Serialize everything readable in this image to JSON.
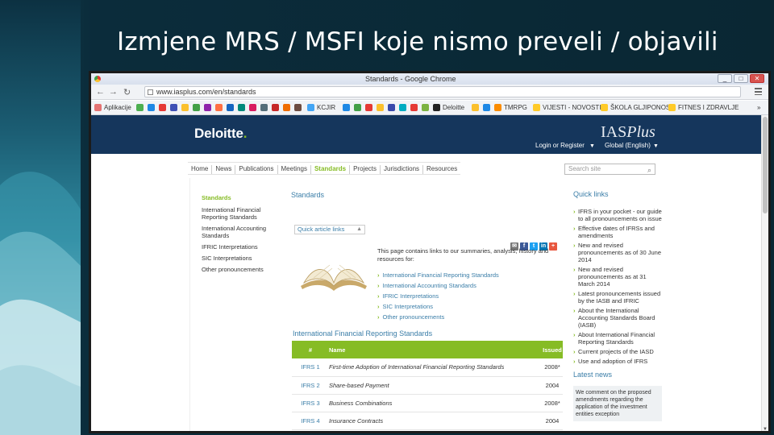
{
  "slide": {
    "title": "Izmjene MRS / MSFI koje nismo preveli / objavili"
  },
  "browser": {
    "window_title": "Standards - Google Chrome",
    "url": "www.iasplus.com/en/standards",
    "buttons": {
      "minimize": "_",
      "maximize": "□",
      "close": "✕"
    },
    "bookmarks": [
      {
        "label": "Aplikacije",
        "color": "#e57373"
      },
      {
        "label": "KCJIR",
        "color": "#42a5f5"
      },
      {
        "label": "Deloitte",
        "color": "#222222"
      },
      {
        "label": "TMRPG",
        "color": "#fb8c00"
      },
      {
        "label": "VIJESTI - NOVOSTI",
        "color": "#ffca28"
      },
      {
        "label": "ŠKOLA GLJIPONOS",
        "color": "#ffca28"
      },
      {
        "label": "FITNES I ZDRAVLJE",
        "color": "#ffca28"
      }
    ],
    "bookmarks_more": "»"
  },
  "site": {
    "logo": "Deloitte",
    "logo_dot": ".",
    "brand_ias": "IAS",
    "brand_plus": "Plus",
    "login": "Login or Register",
    "region": "Global (English)",
    "nav": [
      "Home",
      "News",
      "Publications",
      "Meetings",
      "Standards",
      "Projects",
      "Jurisdictions",
      "Resources"
    ],
    "nav_active": "Standards",
    "search_placeholder": "Search site",
    "leftnav": {
      "heading": "Standards",
      "items": [
        "International Financial Reporting Standards",
        "International Accounting Standards",
        "IFRIC Interpretations",
        "SIC Interpretations",
        "Other pronouncements"
      ]
    },
    "main": {
      "heading": "Standards",
      "quicklinks_dropdown": "Quick article links",
      "intro": "This page contains links to our summaries, analysis, history and resources for:",
      "links": [
        "International Financial Reporting Standards",
        "International Accounting Standards",
        "IFRIC Interpretations",
        "SIC Interpretations",
        "Other pronouncements"
      ],
      "section_heading": "International Financial Reporting Standards",
      "table": {
        "headers": [
          "#",
          "Name",
          "Issued"
        ],
        "rows": [
          {
            "num": "IFRS 1",
            "name": "First-time Adoption of International Financial Reporting Standards",
            "issued": "2008*"
          },
          {
            "num": "IFRS 2",
            "name": "Share-based Payment",
            "issued": "2004"
          },
          {
            "num": "IFRS 3",
            "name": "Business Combinations",
            "issued": "2008*"
          },
          {
            "num": "IFRS 4",
            "name": "Insurance Contracts",
            "issued": "2004"
          }
        ]
      }
    },
    "right": {
      "quick_links_heading": "Quick links",
      "quick_links": [
        "IFRS in your pocket - our guide to all pronouncements on issue",
        "Effective dates of IFRSs and amendments",
        "New and revised pronouncements as of 30 June 2014",
        "New and revised pronouncements as at 31 March 2014",
        "Latest pronouncements issued by the IASB and IFRIC",
        "About the International Accounting Standards Board (IASB)",
        "About International Financial Reporting Standards",
        "Current projects of the IASD",
        "Use and adoption of IFRS"
      ],
      "latest_news_heading": "Latest news",
      "latest_news": "We comment on the proposed amendments regarding the application of the investment entities exception"
    }
  }
}
